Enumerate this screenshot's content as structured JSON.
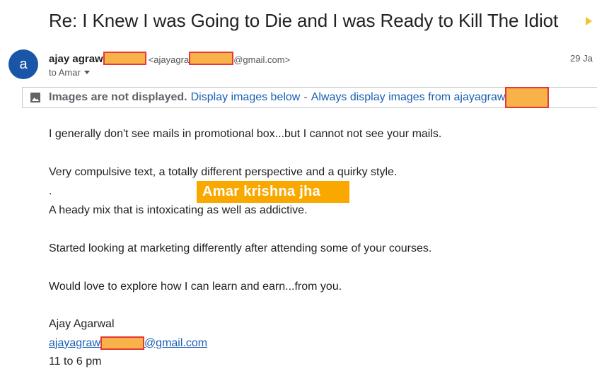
{
  "email": {
    "subject": "Re: I Knew I was Going to Die and I was Ready to Kill The Idiot",
    "sender": {
      "avatar_letter": "a",
      "name": "ajay agraw",
      "email_prefix": "<ajayagra",
      "email_suffix": "@gmail.com>",
      "date": "29 Ja"
    },
    "recipient": {
      "to_label": "to Amar"
    },
    "images_bar": {
      "notice": "Images are not displayed.",
      "display_below": "Display images below",
      "separator": "-",
      "always_display": "Always display images from ajayagraw"
    },
    "body_lines": [
      "I generally don't see mails in promotional box...but I cannot not see your mails.",
      "Very compulsive text, a totally different perspective and a quirky style.",
      ".",
      "A heady mix that is intoxicating as well as addictive.",
      "Started looking at marketing differently after attending some of your courses.",
      "Would love to explore how I can learn and earn...from you."
    ],
    "signature": {
      "name": "Ajay Agarwal",
      "email_prefix": "ajayagraw",
      "email_suffix": "@gmail.com",
      "hours": "11 to 6 pm"
    },
    "watermark": "Amar krishna jha"
  },
  "colors": {
    "avatar_bg": "#1a56a8",
    "link": "#1a5fb4",
    "redaction_fill": "#f7b24a",
    "redaction_border": "#e53935",
    "watermark_bg": "#f9a800",
    "important_marker": "#f4c430"
  },
  "icons": {
    "important": "important-marker-icon",
    "images": "image-icon",
    "recipient_details": "chevron-down-icon"
  }
}
